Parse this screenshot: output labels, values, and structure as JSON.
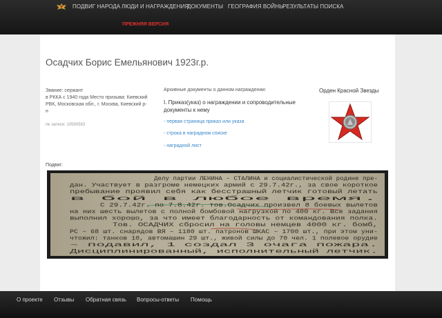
{
  "nav": {
    "items": [
      {
        "label": "ПОДВИГ НАРОДА"
      },
      {
        "label": "ЛЮДИ И НАГРАЖДЕНИЯ"
      },
      {
        "label": "ДОКУМЕНТЫ"
      },
      {
        "label": "ГЕОГРАФИЯ ВОЙНЫ"
      },
      {
        "label": "РЕЗУЛЬТАТЫ ПОИСКА"
      }
    ],
    "old_version": "ПРЕЖНЯЯ ВЕРСИЯ"
  },
  "person": {
    "title": "Осадчих Борис Емельянович 1923г.р.",
    "rank_line": "Звание: сержант",
    "service_line": "в РККА с 1940 года Место призыва: Киевский РВК, Московская обл., г. Москва, Киевский р-н",
    "record_number": "№ записи: 10590583"
  },
  "documents": {
    "section_title": "Архивные документы о данном награждении:",
    "heading": "I. Приказ(указ) о награждении и сопроводительные документы к нему",
    "links": [
      {
        "label": "- первая страница приказ или указа"
      },
      {
        "label": "- строка в наградном списке"
      },
      {
        "label": "- наградной лист"
      }
    ]
  },
  "award": {
    "name": "Орден Красной Звезды",
    "icon": "red-star-order-icon",
    "star_color": "#d42a22"
  },
  "feat": {
    "label": "Подвиг:",
    "lines": [
      "Делу партии ЛЕНИНА – СТАЛИНА и социалистической родине пре-",
      "дан. Участвует в разгроме немецких армий с 29.7.42г., за свое короткое",
      "пребывание проявил себя как бесстрашный летчик готовый летать",
      "в бой в любое время.",
      "С 29.7.42г. по 7.8.42г. тов.Осадчих произвел 8 боевых вылетов",
      "на них шесть вылетов с полной бомбовой нагрузкой по 400 кг. Все задания",
      "выполнил хорошо, за что имеет благодарность от командования полка.",
      "Тов. ОСАДЧИХ сбросил на головы немцев 4000 кг. бомб,",
      "РС – 68 шт. снарядов ВЯ – 1180 шт. патронов ШКАС – 1700 шт., при этом уни-",
      "чтожил: танков 10, автомашин 29 шт., живой силы до 70 чел. 1 полевое орудие",
      "– подавил, 1 создал 3 очага пожара.",
      "Дисциплинированный, исполнительный летчик."
    ]
  },
  "footer": {
    "items": [
      {
        "label": "О проекте"
      },
      {
        "label": "Отзывы"
      },
      {
        "label": "Обратная связь"
      },
      {
        "label": "Вопросы-ответы"
      },
      {
        "label": "Помощь"
      }
    ]
  }
}
